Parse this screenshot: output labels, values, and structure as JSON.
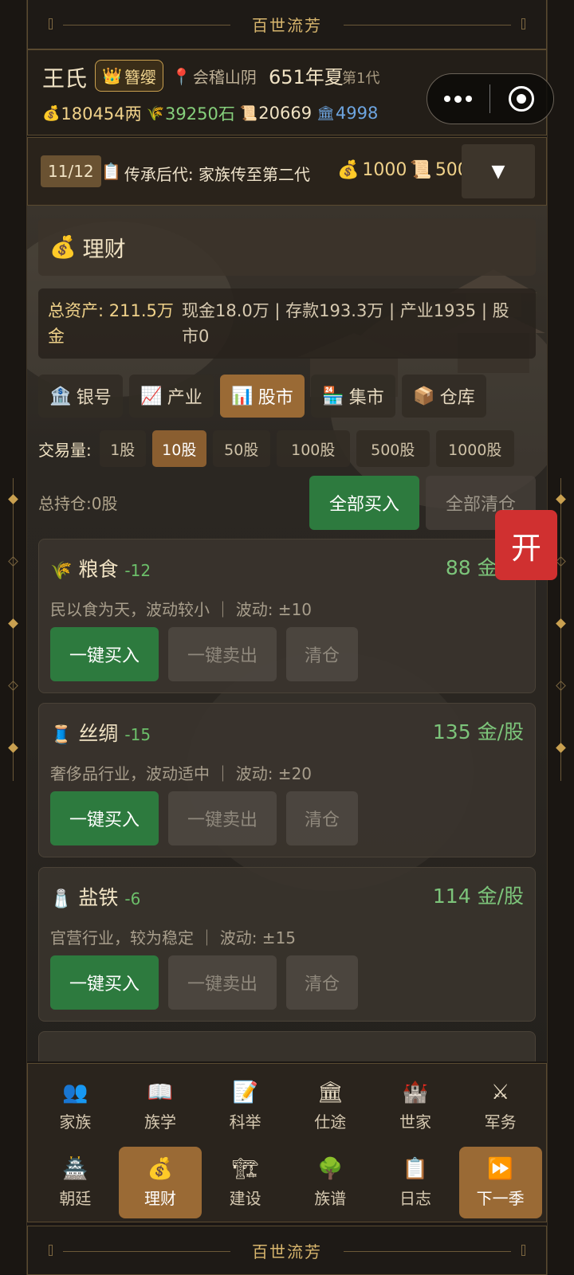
{
  "frame": {
    "title": "百世流芳"
  },
  "header": {
    "clan_name": "王氏",
    "rank": "簪缨",
    "rank_icon": "crown-icon",
    "location": "会稽山阴",
    "year": "651年夏",
    "generation": "第1代",
    "resources": {
      "money": "180454两",
      "grain": "39250石",
      "scrolls": "20669",
      "hall": "4998"
    }
  },
  "quest": {
    "count": "11/12",
    "text": "传承后代: 家族传至第二代",
    "reward_money": "1000",
    "reward_scrolls": "500",
    "toggle": "▼"
  },
  "panel": {
    "title": "理财",
    "asset_total": "总资产: 211.5万金",
    "asset_detail": "现金18.0万 | 存款193.3万 | 产业1935 | 股市0"
  },
  "tabs": [
    {
      "label": "银号",
      "icon": "bank-icon"
    },
    {
      "label": "产业",
      "icon": "chart-up-icon"
    },
    {
      "label": "股市",
      "icon": "bar-chart-icon"
    },
    {
      "label": "集市",
      "icon": "market-icon"
    },
    {
      "label": "仓库",
      "icon": "box-icon"
    }
  ],
  "active_tab": "股市",
  "trade": {
    "label": "交易量:",
    "options": [
      "1股",
      "10股",
      "50股",
      "100股",
      "500股",
      "1000股"
    ],
    "selected": "10股"
  },
  "holding": "总持仓:0股",
  "buy_all": "全部买入",
  "sell_all": "全部清仓",
  "stocks": [
    {
      "name": "粮食",
      "change": "-12",
      "price": "88 金/股",
      "desc": "民以食为天，波动较小 ｜ 波动: ±10",
      "icon": "grain-icon"
    },
    {
      "name": "丝绸",
      "change": "-15",
      "price": "135 金/股",
      "desc": "奢侈品行业，波动适中 ｜ 波动: ±20",
      "icon": "silk-icon"
    },
    {
      "name": "盐铁",
      "change": "-6",
      "price": "114 金/股",
      "desc": "官营行业，较为稳定 ｜ 波动: ±15",
      "icon": "salt-icon"
    }
  ],
  "stock_buttons": {
    "buy": "一键买入",
    "sell": "一键卖出",
    "clear": "清仓"
  },
  "float_button": "开",
  "nav": {
    "row1": [
      {
        "label": "家族",
        "icon": "family-icon"
      },
      {
        "label": "族学",
        "icon": "book-icon"
      },
      {
        "label": "科举",
        "icon": "memo-icon"
      },
      {
        "label": "仕途",
        "icon": "government-icon"
      },
      {
        "label": "世家",
        "icon": "castle-icon"
      },
      {
        "label": "军务",
        "icon": "swords-icon"
      }
    ],
    "row2": [
      {
        "label": "朝廷",
        "icon": "palace-icon"
      },
      {
        "label": "理财",
        "icon": "money-bag-icon"
      },
      {
        "label": "建设",
        "icon": "crane-icon"
      },
      {
        "label": "族谱",
        "icon": "tree-icon"
      },
      {
        "label": "日志",
        "icon": "clipboard-icon"
      },
      {
        "label": "下一季",
        "icon": "fast-forward-icon"
      }
    ],
    "active": "理财"
  },
  "colors": {
    "accent": "#9a6a35",
    "buy_green": "#2d7a3e",
    "price_green": "#7cc47a",
    "gold": "#f0d28a",
    "open_red": "#d03030"
  }
}
